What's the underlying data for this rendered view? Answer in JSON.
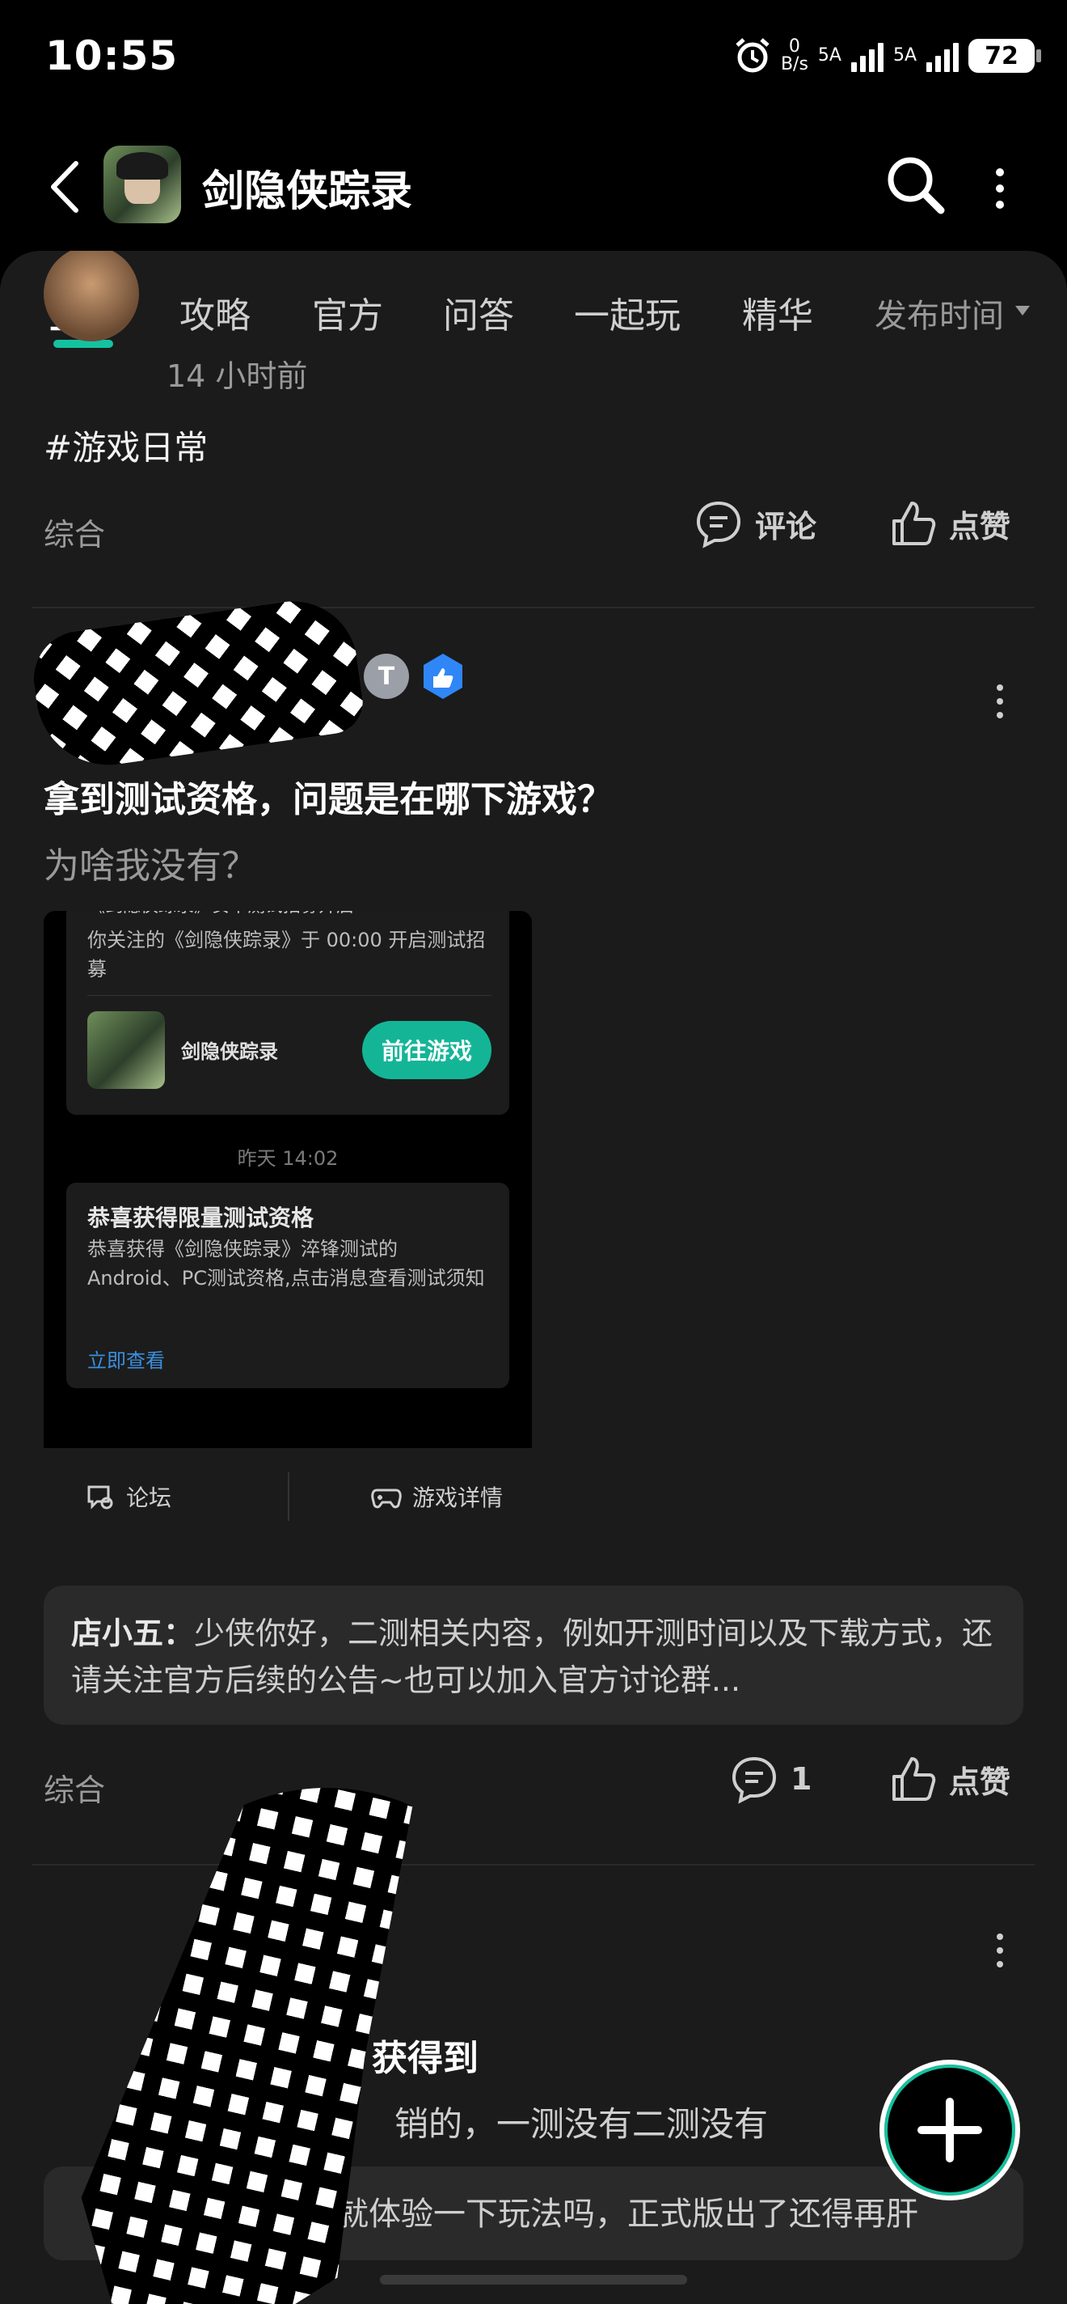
{
  "status_bar": {
    "time": "10:55",
    "net_speed_value": "0",
    "net_speed_unit": "B/s",
    "sim1_label": "5A",
    "sim2_label": "5A",
    "battery": "72"
  },
  "header": {
    "title": "剑隐侠踪录"
  },
  "tabs": [
    {
      "label": "全部"
    },
    {
      "label": "攻略"
    },
    {
      "label": "官方"
    },
    {
      "label": "问答"
    },
    {
      "label": "一起玩"
    },
    {
      "label": "精华"
    }
  ],
  "sort_label": "发布时间",
  "post1": {
    "time": "14 小时前",
    "tag": "#游戏日常",
    "category": "综合",
    "comment_label": "评论",
    "like_label": "点赞"
  },
  "post2": {
    "level_badge": "T",
    "title": "拿到测试资格，问题是在哪下游戏？",
    "body": "为啥我没有？",
    "screenshot": {
      "notice_text": "你关注的《剑隐侠踪录》于 00:00 开启测试招募",
      "notice_head": "《剑隐侠踪录》安卓测试招募开启",
      "game_name": "剑隐侠踪录",
      "go_button": "前往游戏",
      "time": "昨天 14:02",
      "card_title": "恭喜获得限量测试资格",
      "card_text": "恭喜获得《剑隐侠踪录》淬锋测试的Android、PC测试资格,点击消息查看测试须知",
      "card_link": "立即查看",
      "forum_label": "论坛",
      "game_detail_label": "游戏详情"
    },
    "reply_author": "店小五：",
    "reply_text": "少侠你好，二测相关内容，例如开测时间以及下载方式，还请关注官方后续的公告~也可以加入官方讨论群...",
    "category": "综合",
    "comment_count": "1",
    "like_label": "点赞"
  },
  "post3": {
    "title_fragment": "获得到",
    "body_fragment": "销的，一测没有二测没有",
    "reply_fragment": "式不也就体验一下玩法吗，正式版出了还得再肝"
  },
  "colors": {
    "accent": "#14c2a0",
    "background": "#1b1b1b",
    "link": "#3a8fe0"
  }
}
